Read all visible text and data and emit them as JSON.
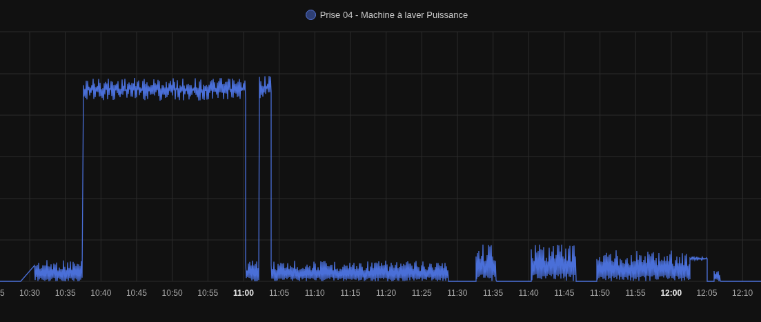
{
  "legend": [
    {
      "label": "Prise 04 - Machine à laver Puissance"
    }
  ],
  "x_axis_labels": [
    {
      "text": "5",
      "bold": false
    },
    {
      "text": "10:30",
      "bold": false
    },
    {
      "text": "10:35",
      "bold": false
    },
    {
      "text": "10:40",
      "bold": false
    },
    {
      "text": "10:45",
      "bold": false
    },
    {
      "text": "10:50",
      "bold": false
    },
    {
      "text": "10:55",
      "bold": false
    },
    {
      "text": "11:00",
      "bold": true
    },
    {
      "text": "11:05",
      "bold": false
    },
    {
      "text": "11:10",
      "bold": false
    },
    {
      "text": "11:15",
      "bold": false
    },
    {
      "text": "11:20",
      "bold": false
    },
    {
      "text": "11:25",
      "bold": false
    },
    {
      "text": "11:30",
      "bold": false
    },
    {
      "text": "11:35",
      "bold": false
    },
    {
      "text": "11:40",
      "bold": false
    },
    {
      "text": "11:45",
      "bold": false
    },
    {
      "text": "11:50",
      "bold": false
    },
    {
      "text": "11:55",
      "bold": false
    },
    {
      "text": "12:00",
      "bold": true
    },
    {
      "text": "12:05",
      "bold": false
    },
    {
      "text": "12:10",
      "bold": false
    }
  ]
}
